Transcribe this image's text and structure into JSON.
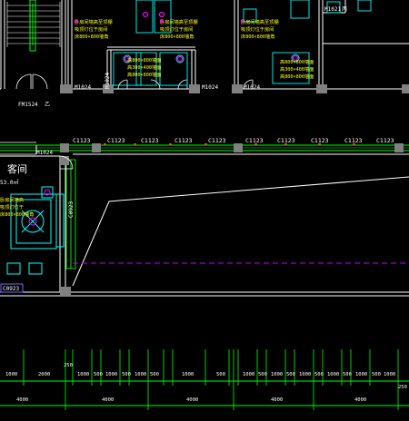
{
  "colors": {
    "background": "#000000",
    "wall": "#ffffff",
    "window": "#00ff00",
    "column": "#808080",
    "door": "#00ffff",
    "annotation_yellow": "#ffff00",
    "annotation_magenta": "#ff00ff",
    "dimension": "#00ff00",
    "red_mark": "#ff3030",
    "dashed_line": "#c000ff"
  },
  "top_rooms": {
    "door_labels": [
      "FM1524",
      "乙",
      "M1024",
      "M1024",
      "M1024",
      "M1024",
      "M1024"
    ],
    "room_tag_right": "丙",
    "room_code_right": "M1021",
    "notes": [
      "卧房间墙高至顶棚",
      "吸顶灯位于房间",
      "床800×800墙角",
      "高800×800墙面",
      "高300×400墙面",
      "高800×800墙面"
    ]
  },
  "windows": {
    "label": "C1123",
    "count": 12
  },
  "room": {
    "name": "客间",
    "area": "53.0㎡",
    "door_label": "M1024",
    "side_window_label": "C0923",
    "lower_label": "C0923",
    "notes": [
      "卧房间墙高",
      "吸顶灯位于",
      "床800×800墙角"
    ]
  },
  "dimensions": {
    "upper_row": [
      "1000",
      "2000",
      "250",
      "1000",
      "500",
      "1000",
      "500",
      "1000",
      "500",
      "1000",
      "500",
      "1000",
      "500",
      "1000",
      "500",
      "1000",
      "500",
      "1000",
      "500",
      "1000",
      "500",
      "1000",
      "250"
    ],
    "lower_row": [
      "4000",
      "4000",
      "4000",
      "4000",
      "4000"
    ],
    "right_end": "250"
  }
}
